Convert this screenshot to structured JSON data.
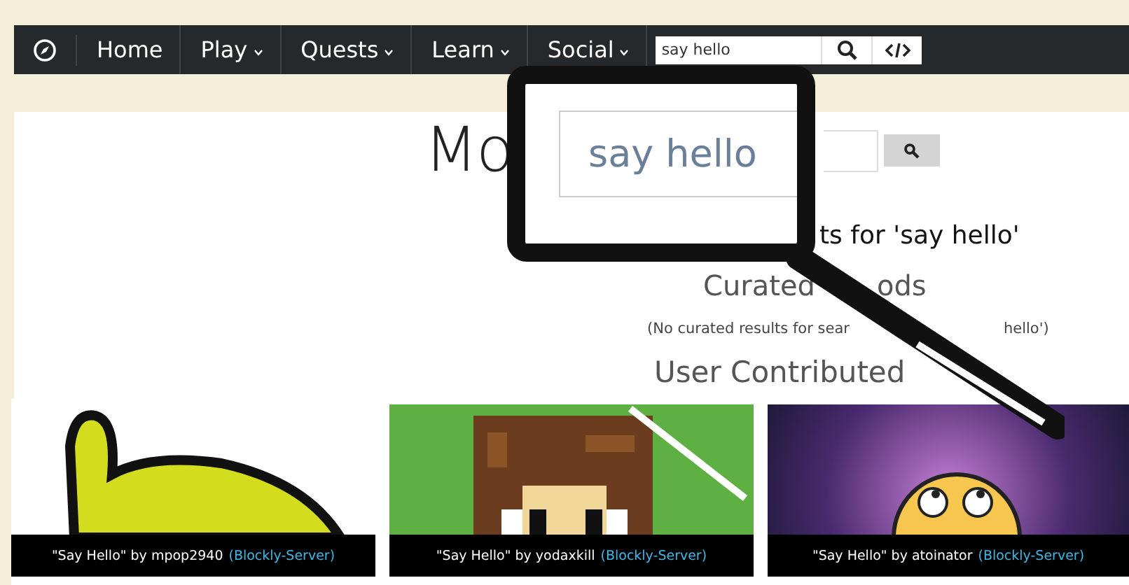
{
  "nav": {
    "items": [
      {
        "label": "Home",
        "dropdown": false
      },
      {
        "label": "Play",
        "dropdown": true
      },
      {
        "label": "Quests",
        "dropdown": true
      },
      {
        "label": "Learn",
        "dropdown": true
      },
      {
        "label": "Social",
        "dropdown": true
      }
    ],
    "search": {
      "value": "say hello"
    }
  },
  "heading": {
    "title": "Mo"
  },
  "magnifier": {
    "value": "say hello"
  },
  "results_title": "ts for 'say hello'",
  "curated": {
    "title_parts": [
      "Curated",
      "ods"
    ],
    "note_parts": [
      "(No curated results for sear",
      "hello')"
    ]
  },
  "user_title": "User Contributed",
  "cards": [
    {
      "kind": "blob",
      "title": "\"Say Hello\" by mpop2940",
      "tag": "(Blockly-Server)"
    },
    {
      "kind": "pixel",
      "title": "\"Say Hello\" by yodaxkill",
      "tag": "(Blockly-Server)"
    },
    {
      "kind": "space",
      "title": "\"Say Hello\" by atoinator",
      "tag": "(Blockly-Server)"
    }
  ]
}
